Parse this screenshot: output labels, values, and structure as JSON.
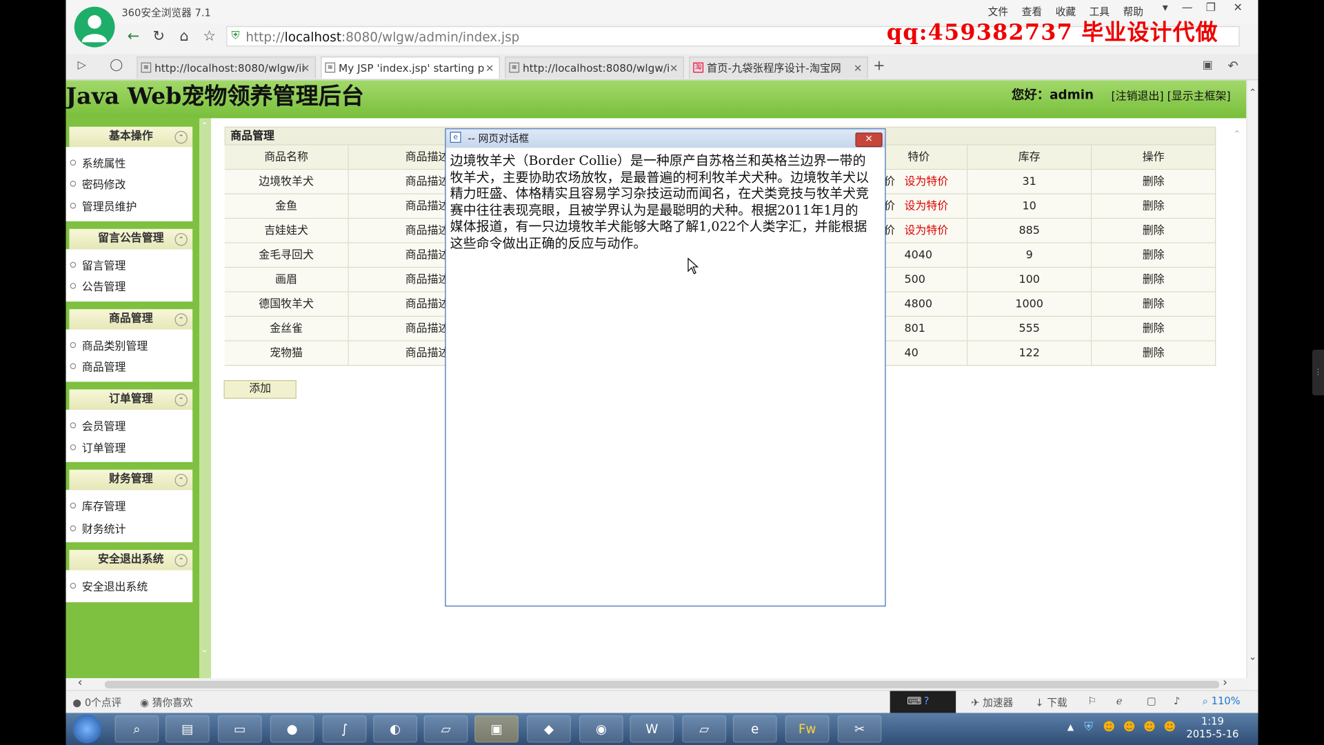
{
  "browser": {
    "app_title": "360安全浏览器 7.1",
    "menu": [
      "文件",
      "查看",
      "收藏",
      "工具",
      "帮助"
    ],
    "url_prefix": "http://",
    "url_host": "localhost",
    "url_rest": ":8080/wlgw/admin/index.jsp",
    "tabs": [
      {
        "label": "http://localhost:8080/wlgw/ii"
      },
      {
        "label": "My JSP 'index.jsp' starting p"
      },
      {
        "label": "http://localhost:8080/wlgw/i"
      },
      {
        "label": "首页-九袋张程序设计-淘宝网"
      }
    ],
    "new_tab": "+"
  },
  "watermark": "qq:459382737 毕业设计代做",
  "header": {
    "title": "Java Web宠物领养管理后台",
    "greeting_label": "您好：",
    "username": "admin",
    "logout_link": "[注销退出]",
    "frame_link": "[显示主框架]"
  },
  "sidebar": {
    "sections": [
      {
        "title": "基本操作",
        "items": [
          "系统属性",
          "密码修改",
          "管理员维护"
        ]
      },
      {
        "title": "留言公告管理",
        "items": [
          "留言管理",
          "公告管理"
        ]
      },
      {
        "title": "商品管理",
        "items": [
          "商品类别管理",
          "商品管理"
        ]
      },
      {
        "title": "订单管理",
        "items": [
          "会员管理",
          "订单管理"
        ]
      },
      {
        "title": "财务管理",
        "items": [
          "库存管理",
          "财务统计"
        ]
      },
      {
        "title": "安全退出系统",
        "items": [
          "安全退出系统"
        ]
      }
    ]
  },
  "main": {
    "panel_title": "商品管理",
    "columns_left": [
      "商品名称",
      "商品描述"
    ],
    "columns_right": [
      "特价",
      "库存",
      "操作"
    ],
    "rows": [
      {
        "name": "边境牧羊犬",
        "desc": "商品描述",
        "special": "设为特价",
        "price_fragment": "价",
        "stock": "31",
        "action": "删除"
      },
      {
        "name": "金鱼",
        "desc": "商品描述",
        "special": "设为特价",
        "price_fragment": "价",
        "stock": "10",
        "action": "删除"
      },
      {
        "name": "吉娃娃犬",
        "desc": "商品描述",
        "special": "设为特价",
        "price_fragment": "价",
        "stock": "885",
        "action": "删除"
      },
      {
        "name": "金毛寻回犬",
        "desc": "商品描述",
        "special": "4040",
        "price_fragment": "",
        "stock": "9",
        "action": "删除"
      },
      {
        "name": "画眉",
        "desc": "商品描述",
        "special": "500",
        "price_fragment": "",
        "stock": "100",
        "action": "删除"
      },
      {
        "name": "德国牧羊犬",
        "desc": "商品描述",
        "special": "4800",
        "price_fragment": "",
        "stock": "1000",
        "action": "删除"
      },
      {
        "name": "金丝雀",
        "desc": "商品描述",
        "special": "801",
        "price_fragment": "",
        "stock": "555",
        "action": "删除"
      },
      {
        "name": "宠物猫",
        "desc": "商品描述",
        "special": "40",
        "price_fragment": "",
        "stock": "122",
        "action": "删除"
      }
    ],
    "add_button": "添加"
  },
  "dialog": {
    "title": "-- 网页对话框",
    "close": "✕",
    "text": "边境牧羊犬（Border Collie）是一种原产自苏格兰和英格兰边界一带的牧羊犬，主要协助农场放牧，是最普遍的柯利牧羊犬犬种。边境牧羊犬以精力旺盛、体格精实且容易学习杂技运动而闻名，在犬类竞技与牧羊犬竞赛中往往表现亮眼，且被学界认为是最聪明的犬种。根据2011年1月的媒体报道，有一只边境牧羊犬能够大略了解1,022个人类字汇，并能根据这些命令做出正确的反应与动作。"
  },
  "statusbar": {
    "comments": "0个点评",
    "guess": "猜你喜欢",
    "accelerator": "加速器",
    "download": "下载",
    "zoom": "110%"
  },
  "taskbar": {
    "time": "1:19",
    "date": "2015-5-16"
  }
}
